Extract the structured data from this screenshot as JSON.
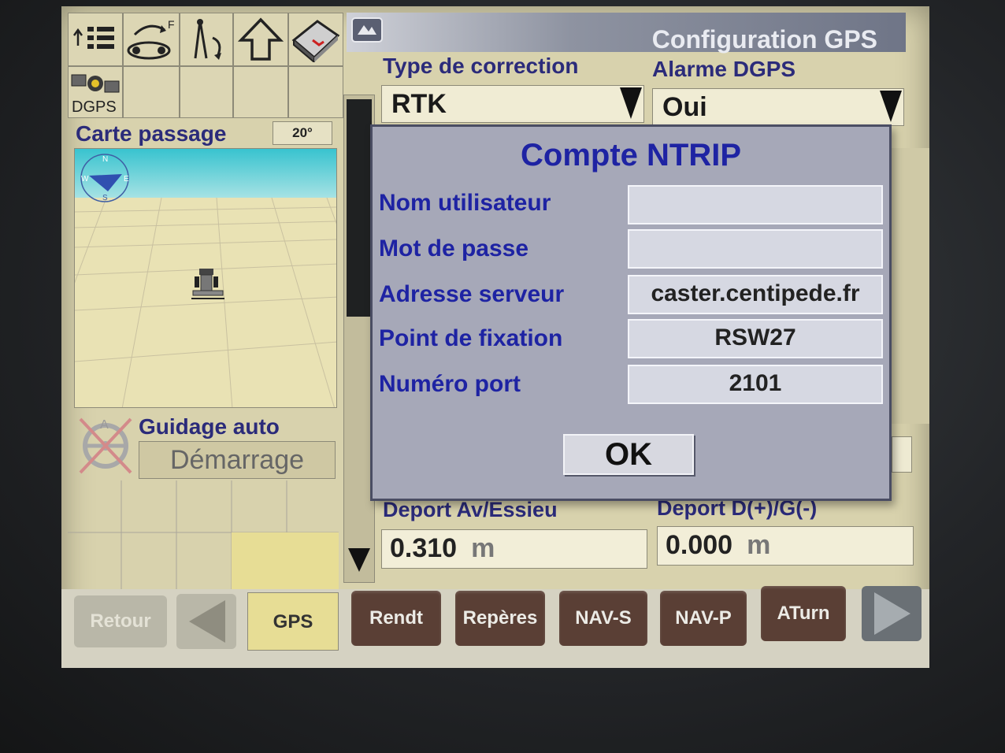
{
  "toolbar": {
    "dgps_label": "DGPS"
  },
  "carte": {
    "title": "Carte passage",
    "angle": "20°"
  },
  "guidage": {
    "title": "Guidage auto",
    "start_label": "Démarrage"
  },
  "config": {
    "title": "Configuration GPS",
    "correction_label": "Type de correction",
    "correction_value": "RTK",
    "alarm_label": "Alarme DGPS",
    "alarm_value": "Oui",
    "deport_av_label": "Deport Av/Essieu",
    "deport_av_value": "0.310",
    "deport_av_unit": "m",
    "deport_dg_label": "Deport D(+)/G(-)",
    "deport_dg_value": "0.000",
    "deport_dg_unit": "m"
  },
  "modal": {
    "title": "Compte NTRIP",
    "fields": [
      {
        "label": "Nom utilisateur",
        "value": ""
      },
      {
        "label": "Mot de passe",
        "value": ""
      },
      {
        "label": "Adresse serveur",
        "value": "caster.centipede.fr"
      },
      {
        "label": "Point de fixation",
        "value": "RSW27"
      },
      {
        "label": "Numéro port",
        "value": "2101"
      }
    ],
    "ok_label": "OK"
  },
  "nav": {
    "retour": "Retour",
    "gps": "GPS",
    "items": [
      "Rendt",
      "Repères",
      "NAV-S",
      "NAV-P",
      "ATurn"
    ]
  },
  "colors": {
    "accent": "#1e23a3",
    "label": "#2b2b7a",
    "nav_bg": "#5a3f35"
  }
}
